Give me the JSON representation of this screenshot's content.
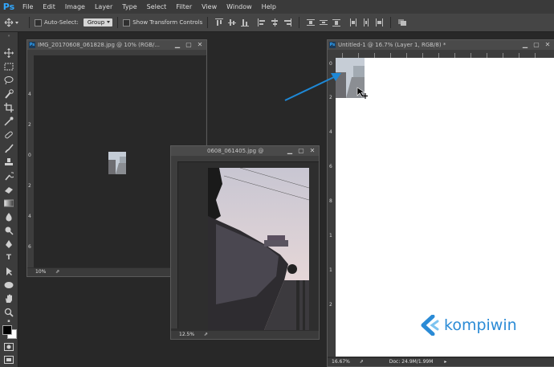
{
  "menu": {
    "logo": "Ps",
    "items": [
      "File",
      "Edit",
      "Image",
      "Layer",
      "Type",
      "Select",
      "Filter",
      "View",
      "Window",
      "Help"
    ]
  },
  "options": {
    "auto_select_label": "Auto-Select:",
    "auto_select_value": "Group",
    "show_transform_label": "Show Transform Controls"
  },
  "windows": {
    "doc1": {
      "title": "IMG_20170608_061828.jpg @ 10% (RGB/...",
      "zoom": "10%",
      "ruler_v": [
        "4",
        "2",
        "0",
        "2",
        "4",
        "6"
      ]
    },
    "doc2": {
      "title": "0608_061405.jpg @",
      "zoom": "12.5%"
    },
    "doc3": {
      "title": "Untitled-1 @ 16.7% (Layer 1, RGB/8) *",
      "zoom": "16.67%",
      "doc_info": "Doc: 24.9M/1.99M",
      "ruler_v": [
        "0",
        "2",
        "4",
        "6",
        "8",
        "1",
        "1",
        "2"
      ]
    }
  },
  "watermark": {
    "text": "kompiwin",
    "color": "#2b8bd6"
  },
  "colors": {
    "arrow": "#1e88d6",
    "ps_blue": "#31a8ff"
  },
  "icons": [
    "move-icon",
    "marquee-icon",
    "lasso-icon",
    "quick-select-icon",
    "crop-icon",
    "eyedropper-icon",
    "healing-icon",
    "brush-icon",
    "stamp-icon",
    "history-brush-icon",
    "eraser-icon",
    "gradient-icon",
    "blur-icon",
    "dodge-icon",
    "pen-icon",
    "type-icon",
    "path-select-icon",
    "shape-icon",
    "hand-icon",
    "zoom-icon"
  ]
}
